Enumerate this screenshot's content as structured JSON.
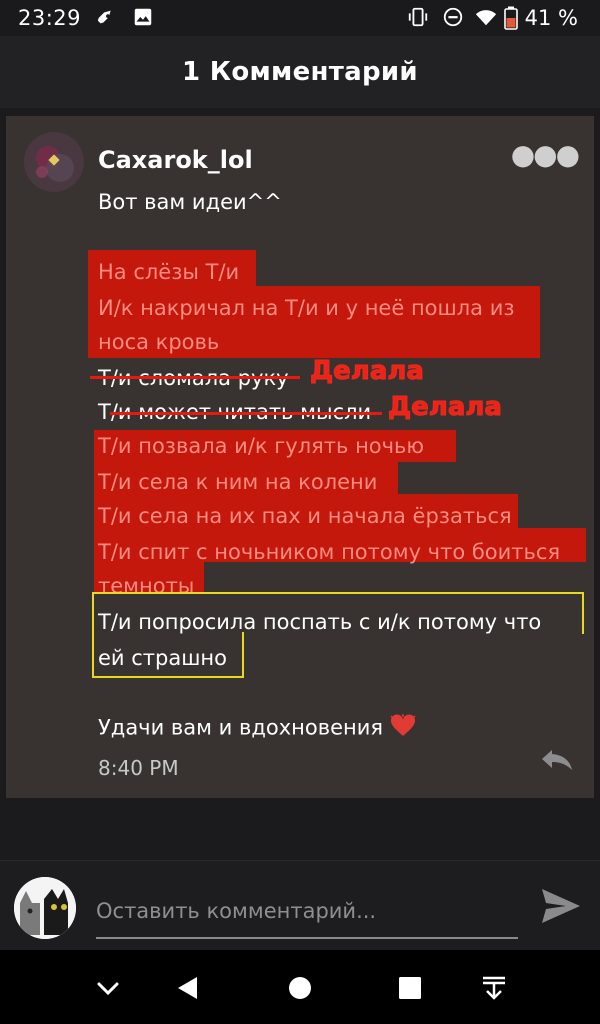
{
  "status": {
    "time": "23:29",
    "battery": "41 %"
  },
  "header": {
    "title": "1 Комментарий"
  },
  "comment": {
    "username": "Caxarok_lol",
    "greeting": "Вот вам идеи^^",
    "ideas": [
      "На слёзы Т/и",
      "И/к накричал на Т/и и у неё пошла из",
      "носа кровь",
      "Т/и сломала руку",
      "Т/и может читать мысли",
      "Т/и позвала и/к гулять ночью",
      "Т/и села к ним на колени",
      "Т/и села на их пах и начала ёрзаться",
      "Т/и спит с ночьником потому что боиться",
      "темноты",
      "Т/и попросила поспать с и/к потому что",
      "ей страшно"
    ],
    "done_label": "Делала",
    "closing": "Удачи вам и вдохновения",
    "time": "8:40 PM"
  },
  "composer": {
    "placeholder": "Оставить комментарий..."
  },
  "colors": {
    "highlight": "#c4180c",
    "yellow_box": "#e7d820",
    "card_bg": "#383330"
  },
  "icons": [
    "rocket-icon",
    "image-icon",
    "vibrate-icon",
    "dnd-icon",
    "wifi-icon",
    "battery-icon",
    "more-icon",
    "heart-icon",
    "reply-icon",
    "send-icon",
    "chevron-down-icon",
    "back-icon",
    "home-icon",
    "recents-icon",
    "hide-keyboard-icon"
  ]
}
